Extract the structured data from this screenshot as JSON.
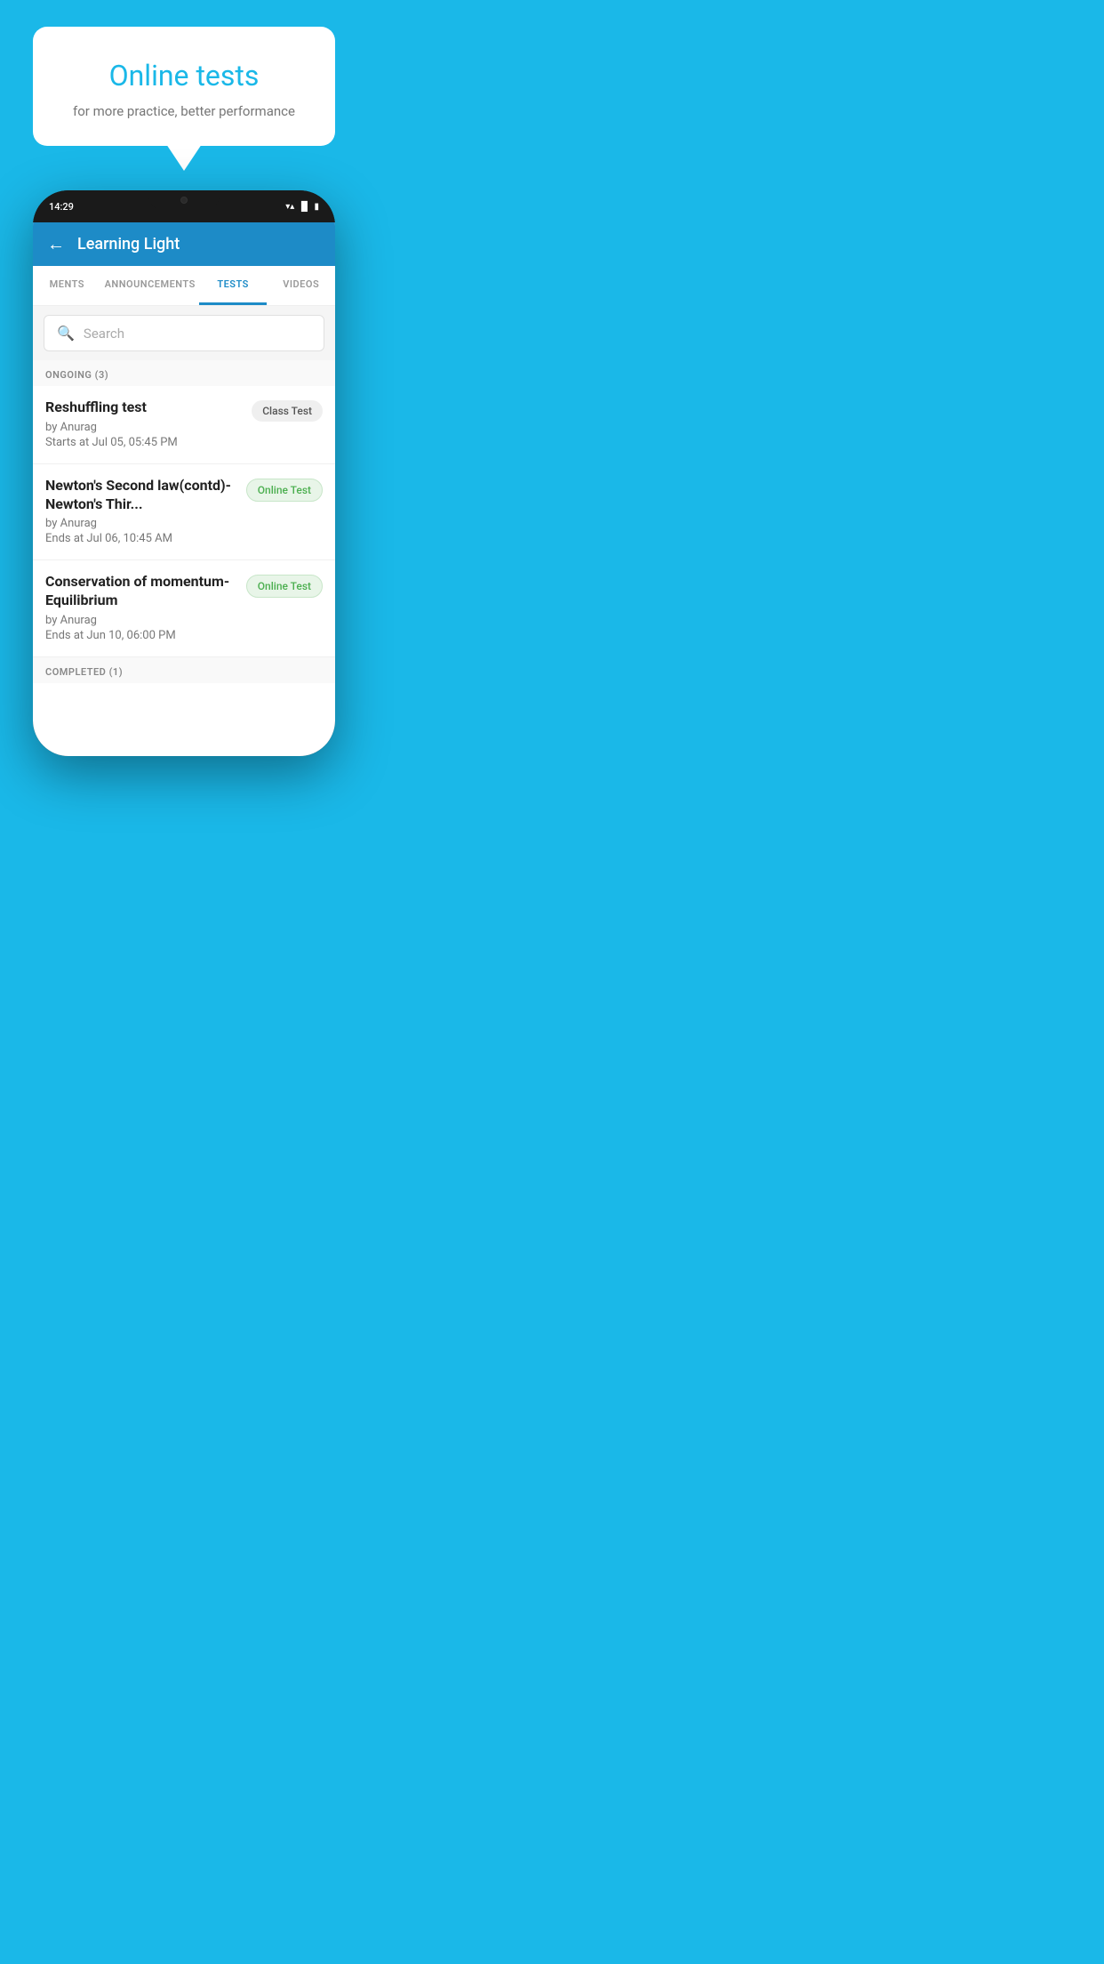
{
  "background_color": "#1ab8e8",
  "bubble": {
    "title": "Online tests",
    "subtitle": "for more practice, better performance"
  },
  "phone": {
    "status_bar": {
      "time": "14:29",
      "icons": [
        "▼",
        "▲",
        "▌"
      ]
    },
    "header": {
      "title": "Learning Light",
      "back_label": "←"
    },
    "tabs": [
      {
        "label": "MENTS",
        "active": false
      },
      {
        "label": "ANNOUNCEMENTS",
        "active": false
      },
      {
        "label": "TESTS",
        "active": true
      },
      {
        "label": "VIDEOS",
        "active": false
      }
    ],
    "search": {
      "placeholder": "Search"
    },
    "ongoing_section": {
      "label": "ONGOING (3)"
    },
    "tests": [
      {
        "title": "Reshuffling test",
        "author": "by Anurag",
        "date": "Starts at  Jul 05, 05:45 PM",
        "badge": "Class Test",
        "badge_type": "class"
      },
      {
        "title": "Newton's Second law(contd)-Newton's Thir...",
        "author": "by Anurag",
        "date": "Ends at  Jul 06, 10:45 AM",
        "badge": "Online Test",
        "badge_type": "online"
      },
      {
        "title": "Conservation of momentum-Equilibrium",
        "author": "by Anurag",
        "date": "Ends at  Jun 10, 06:00 PM",
        "badge": "Online Test",
        "badge_type": "online"
      }
    ],
    "completed_section": {
      "label": "COMPLETED (1)"
    }
  }
}
